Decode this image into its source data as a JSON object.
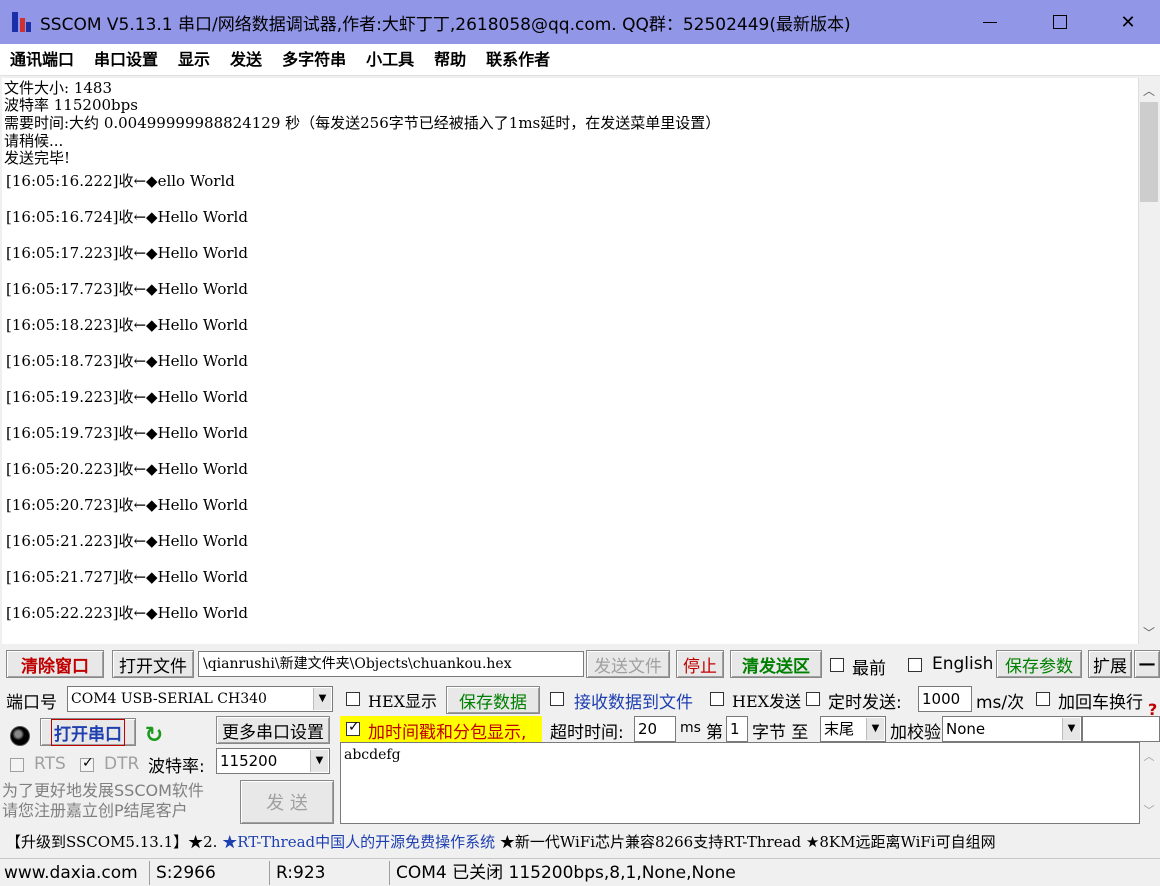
{
  "window": {
    "title": "SSCOM V5.13.1 串口/网络数据调试器,作者:大虾丁丁,2618058@qq.com. QQ群：52502449(最新版本)",
    "minimize": "—",
    "maximize": "☐",
    "close": "✕"
  },
  "menu": [
    "通讯端口",
    "串口设置",
    "显示",
    "发送",
    "多字符串",
    "小工具",
    "帮助",
    "联系作者"
  ],
  "receive": {
    "info_lines": [
      "文件大小: 1483",
      "波特率 115200bps",
      "需要时间:大约 0.00499999988824129 秒（每发送256字节已经被插入了1ms延时，在发送菜单里设置）",
      "请稍候...",
      "发送完毕!"
    ],
    "log_lines": [
      "[16:05:16.222]收←◆ello World",
      "[16:05:16.724]收←◆Hello World",
      "[16:05:17.223]收←◆Hello World",
      "[16:05:17.723]收←◆Hello World",
      "[16:05:18.223]收←◆Hello World",
      "[16:05:18.723]收←◆Hello World",
      "[16:05:19.223]收←◆Hello World",
      "[16:05:19.723]收←◆Hello World",
      "[16:05:20.223]收←◆Hello World",
      "[16:05:20.723]收←◆Hello World",
      "[16:05:21.223]收←◆Hello World",
      "[16:05:21.727]收←◆Hello World",
      "[16:05:22.223]收←◆Hello World"
    ]
  },
  "toolbar": {
    "clear_window": "清除窗口",
    "open_file": "打开文件",
    "file_path": "\\qianrushi\\新建文件夹\\Objects\\chuankou.hex",
    "send_file": "发送文件",
    "stop": "停止",
    "clear_send": "清发送区",
    "topmost": "最前",
    "english": "English",
    "save_params": "保存参数",
    "expand": "扩展",
    "collapse": "—"
  },
  "port": {
    "port_label": "端口号",
    "port_value": "COM4 USB-SERIAL CH340",
    "hex_display": "HEX显示",
    "save_data": "保存数据",
    "recv_to_file": "接收数据到文件",
    "hex_send": "HEX发送",
    "timed_send": "定时发送:",
    "interval": "1000",
    "interval_unit": "ms/次",
    "add_crlf": "加回车换行",
    "help_mark": "?",
    "open_port": "打开串口",
    "more_settings": "更多串口设置",
    "timestamp": "加时间戳和分包显示,",
    "timeout_label": "超时时间:",
    "timeout_value": "20",
    "timeout_unit": "ms",
    "nth_label": "第",
    "nth_value": "1",
    "byte_label": "字节 至",
    "end_value": "末尾",
    "checksum_label": "加校验",
    "checksum_value": "None",
    "rts": "RTS",
    "dtr": "DTR",
    "baud_label": "波特率:",
    "baud_value": "115200",
    "send_text": "abcdefg",
    "send_button": "发  送",
    "promo": "为了更好地发展SSCOM软件\n请您注册嘉立创P结尾客户"
  },
  "marquee": {
    "part1": "【升级到SSCOM5.13.1】★2. ",
    "part2": "★RT-Thread中国人的开源免费操作系统",
    "part3": " ★新一代WiFi芯片兼容8266支持RT-Thread ★8KM远距离WiFi可自组网"
  },
  "status": {
    "site": "www.daxia.com",
    "sent": "S:2966",
    "received": "R:923",
    "port_state": "COM4 已关闭  115200bps,8,1,None,None"
  },
  "colors": {
    "titlebar": "#9196e6",
    "highlight": "#ffff00",
    "red_text": "#c00000",
    "green_text": "#008000",
    "link_blue": "#1e3fb0"
  }
}
